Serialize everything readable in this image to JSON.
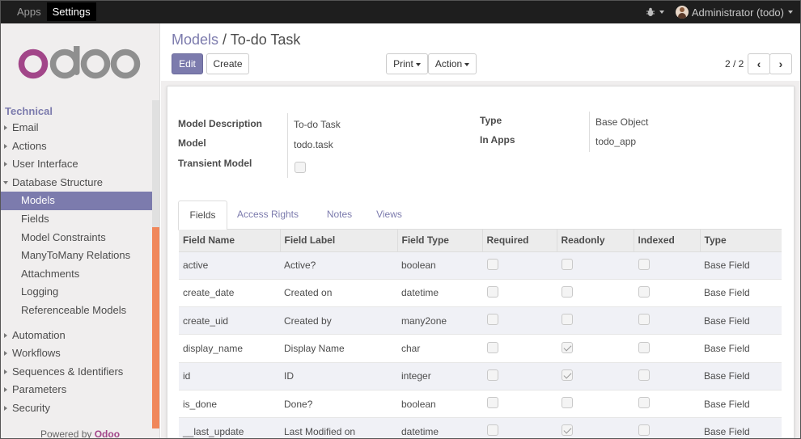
{
  "topbar": {
    "apps_label": "Apps",
    "settings_label": "Settings",
    "user_label": "Administrator (todo)"
  },
  "sidebar": {
    "section": "Technical",
    "items": [
      {
        "label": "Email",
        "level": 0,
        "expanded": false
      },
      {
        "label": "Actions",
        "level": 0,
        "expanded": false
      },
      {
        "label": "User Interface",
        "level": 0,
        "expanded": false
      },
      {
        "label": "Database Structure",
        "level": 0,
        "expanded": true
      },
      {
        "label": "Models",
        "level": 1,
        "active": true
      },
      {
        "label": "Fields",
        "level": 1
      },
      {
        "label": "Model Constraints",
        "level": 1
      },
      {
        "label": "ManyToMany Relations",
        "level": 1
      },
      {
        "label": "Attachments",
        "level": 1
      },
      {
        "label": "Logging",
        "level": 1
      },
      {
        "label": "Referenceable Models",
        "level": 1
      },
      {
        "label": "Automation",
        "level": 0,
        "expanded": false
      },
      {
        "label": "Workflows",
        "level": 0,
        "expanded": false
      },
      {
        "label": "Sequences & Identifiers",
        "level": 0,
        "expanded": false
      },
      {
        "label": "Parameters",
        "level": 0,
        "expanded": false
      },
      {
        "label": "Security",
        "level": 0,
        "expanded": false
      }
    ],
    "powered_prefix": "Powered by ",
    "powered_brand": "Odoo"
  },
  "header": {
    "breadcrumb_parent": "Models",
    "breadcrumb_sep": " / ",
    "breadcrumb_current": "To-do Task",
    "edit_label": "Edit",
    "create_label": "Create",
    "print_label": "Print",
    "action_label": "Action",
    "pager": "2 / 2"
  },
  "form": {
    "model_description_label": "Model Description",
    "model_description": "To-do Task",
    "model_label": "Model",
    "model": "todo.task",
    "transient_label": "Transient Model",
    "transient": false,
    "type_label": "Type",
    "type": "Base Object",
    "in_apps_label": "In Apps",
    "in_apps": "todo_app"
  },
  "tabs": [
    "Fields",
    "Access Rights",
    "Notes",
    "Views"
  ],
  "table": {
    "columns": [
      "Field Name",
      "Field Label",
      "Field Type",
      "Required",
      "Readonly",
      "Indexed",
      "Type"
    ],
    "rows": [
      {
        "name": "active",
        "label": "Active?",
        "ftype": "boolean",
        "required": false,
        "readonly": false,
        "indexed": false,
        "type": "Base Field"
      },
      {
        "name": "create_date",
        "label": "Created on",
        "ftype": "datetime",
        "required": false,
        "readonly": false,
        "indexed": false,
        "type": "Base Field"
      },
      {
        "name": "create_uid",
        "label": "Created by",
        "ftype": "many2one",
        "required": false,
        "readonly": false,
        "indexed": false,
        "type": "Base Field"
      },
      {
        "name": "display_name",
        "label": "Display Name",
        "ftype": "char",
        "required": false,
        "readonly": true,
        "indexed": false,
        "type": "Base Field"
      },
      {
        "name": "id",
        "label": "ID",
        "ftype": "integer",
        "required": false,
        "readonly": true,
        "indexed": false,
        "type": "Base Field"
      },
      {
        "name": "is_done",
        "label": "Done?",
        "ftype": "boolean",
        "required": false,
        "readonly": false,
        "indexed": false,
        "type": "Base Field"
      },
      {
        "name": "__last_update",
        "label": "Last Modified on",
        "ftype": "datetime",
        "required": false,
        "readonly": true,
        "indexed": false,
        "type": "Base Field"
      }
    ]
  },
  "colors": {
    "accent": "#7c7bad",
    "brand": "#a24689",
    "scroll_thumb": "#f0875b"
  }
}
